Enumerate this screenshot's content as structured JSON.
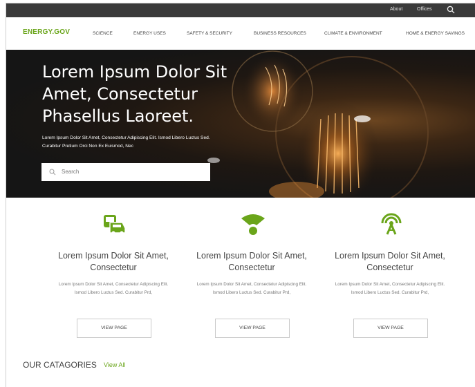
{
  "topbar": {
    "about": "About",
    "offices": "Offices"
  },
  "nav": {
    "logo": "ENERGY.GOV",
    "items": [
      "SCIENCE",
      "ENERGY USES",
      "SAFETY & SECURITY",
      "BUSINESS RESOURCES",
      "CLIMATE & ENVIRONMENT",
      "HOME & ENERGY SAVINGS"
    ]
  },
  "hero": {
    "title": "Lorem Ipsum Dolor Sit Amet, Consectetur Phasellus Laoreet.",
    "subtitle": "Lorem Ipsum Dolor Sit Amet, Consectetur Adipiscing Elit. Ismod Libero Luctus Sed. Curabitur Pretium Orci Non Ex Euismod, Nec",
    "search_placeholder": "Search"
  },
  "cards": [
    {
      "icon": "car-bus-icon",
      "title": "Lorem Ipsum Dolor Sit Amet, Consectetur",
      "desc": "Lorem Ipsum Dolor Sit Amet, Consectetur Adipiscing Elit. Ismod Libero Luctus Sed. Curabitur Prd,",
      "button": "VIEW PAGE"
    },
    {
      "icon": "wifi-signal-icon",
      "title": "Lorem Ipsum Dolor Sit Amet, Consectetur",
      "desc": "Lorem Ipsum Dolor Sit Amet, Consectetur Adipiscing Elit. Ismod Libero Luctus Sed. Curabitur Prd,",
      "button": "VIEW PAGE"
    },
    {
      "icon": "antenna-icon",
      "title": "Lorem Ipsum Dolor Sit Amet, Consectetur",
      "desc": "Lorem Ipsum Dolor Sit Amet, Consectetur Adipiscing Elit. Ismod Libero Luctus Sed. Curabitur Prd,",
      "button": "VIEW PAGE"
    }
  ],
  "categories": {
    "heading": "OUR CATAGORIES",
    "view_all": "View All"
  },
  "colors": {
    "accent": "#6aa51a",
    "topbar": "#3a3a3a"
  }
}
